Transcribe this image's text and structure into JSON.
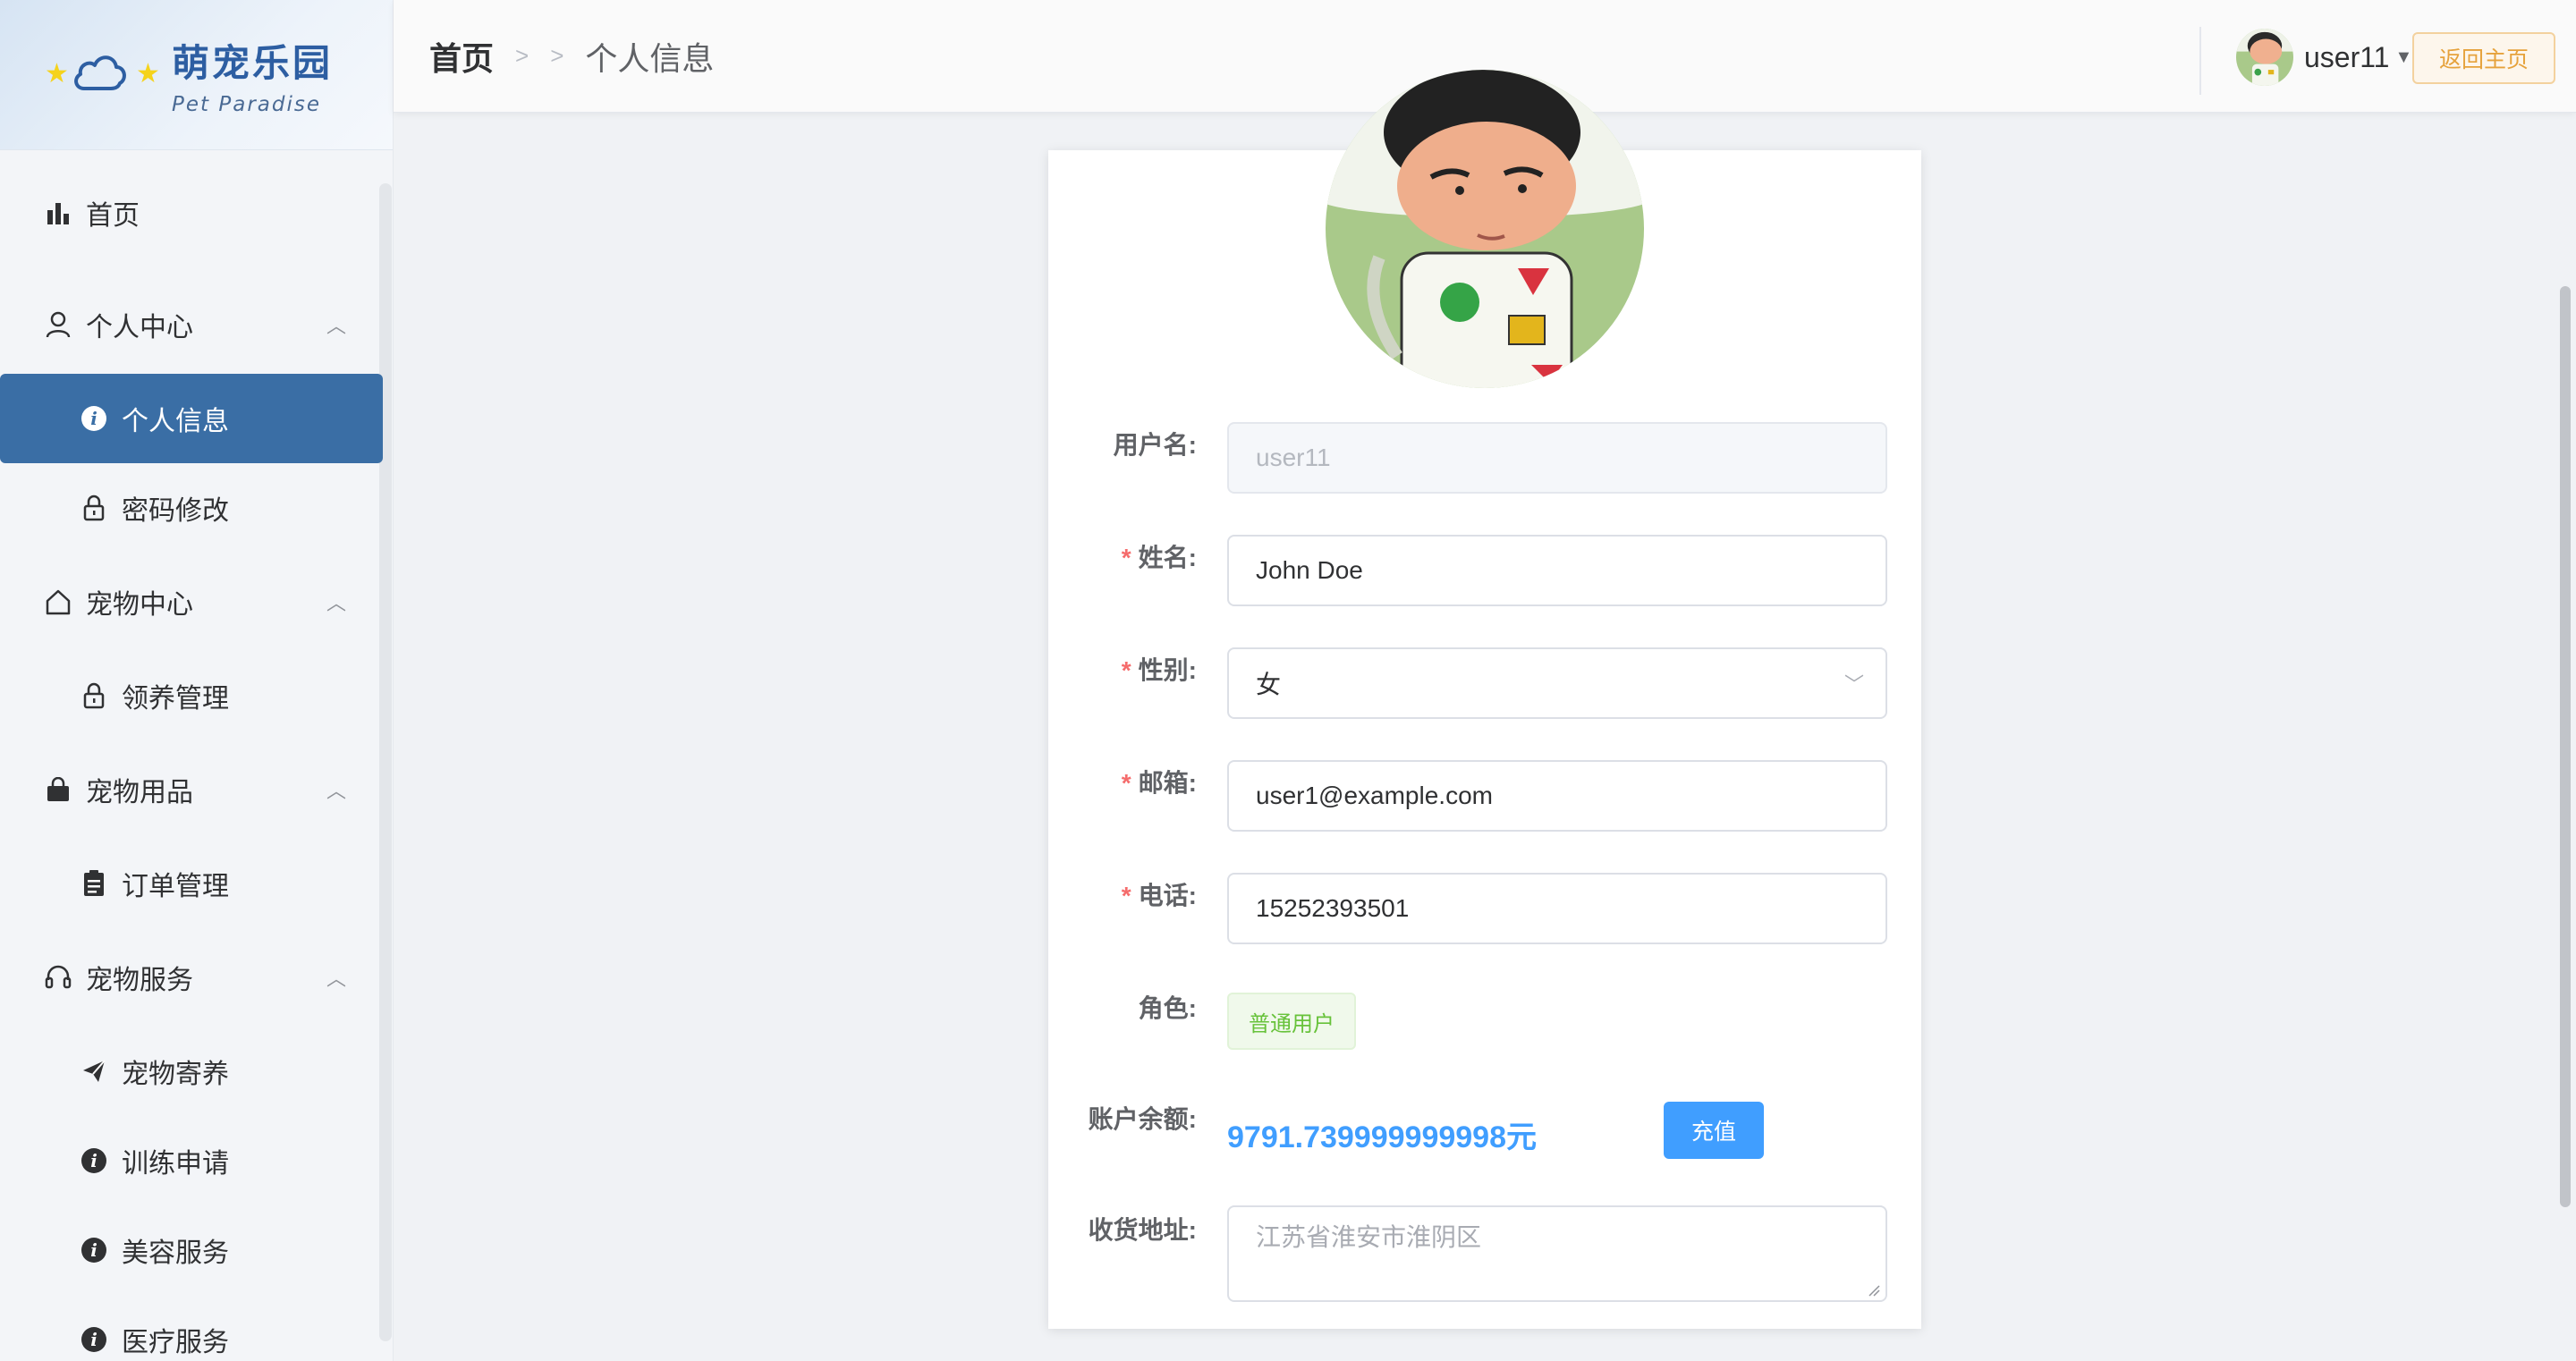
{
  "app": {
    "title": "萌宠乐园",
    "subtitle": "Pet Paradise"
  },
  "sidebar": {
    "items": [
      {
        "label": "首页",
        "icon": "bar-chart-icon"
      },
      {
        "label": "个人中心",
        "icon": "user-icon",
        "expanded": true
      },
      {
        "label": "个人信息",
        "icon": "info-icon",
        "active": true
      },
      {
        "label": "密码修改",
        "icon": "lock-icon"
      },
      {
        "label": "宠物中心",
        "icon": "home-icon",
        "expanded": true
      },
      {
        "label": "领养管理",
        "icon": "lock-icon"
      },
      {
        "label": "宠物用品",
        "icon": "shopping-bag-icon",
        "expanded": true
      },
      {
        "label": "订单管理",
        "icon": "clipboard-icon"
      },
      {
        "label": "宠物服务",
        "icon": "headset-icon",
        "expanded": true
      },
      {
        "label": "宠物寄养",
        "icon": "send-icon"
      },
      {
        "label": "训练申请",
        "icon": "info-icon"
      },
      {
        "label": "美容服务",
        "icon": "info-icon"
      },
      {
        "label": "医疗服务",
        "icon": "info-icon"
      }
    ]
  },
  "header": {
    "breadcrumb_home": "首页",
    "breadcrumb_current": "个人信息",
    "username": "user11",
    "back_button": "返回主页"
  },
  "form": {
    "username_label": "用户名:",
    "username_value": "user11",
    "name_label": "姓名:",
    "name_value": "John Doe",
    "gender_label": "性别:",
    "gender_value": "女",
    "email_label": "邮箱:",
    "email_value": "user1@example.com",
    "phone_label": "电话:",
    "phone_value": "15252393501",
    "role_label": "角色:",
    "role_value": "普通用户",
    "balance_label": "账户余额:",
    "balance_value": "9791.739999999998元",
    "recharge_button": "充值",
    "address_label": "收货地址:",
    "address_value": "江苏省淮安市淮阴区"
  },
  "colors": {
    "primary": "#409eff",
    "sidebar_active": "#3a6ea5",
    "required": "#f56c6c",
    "tag_green": "#67c23a",
    "back_button": "#e6a23c"
  }
}
